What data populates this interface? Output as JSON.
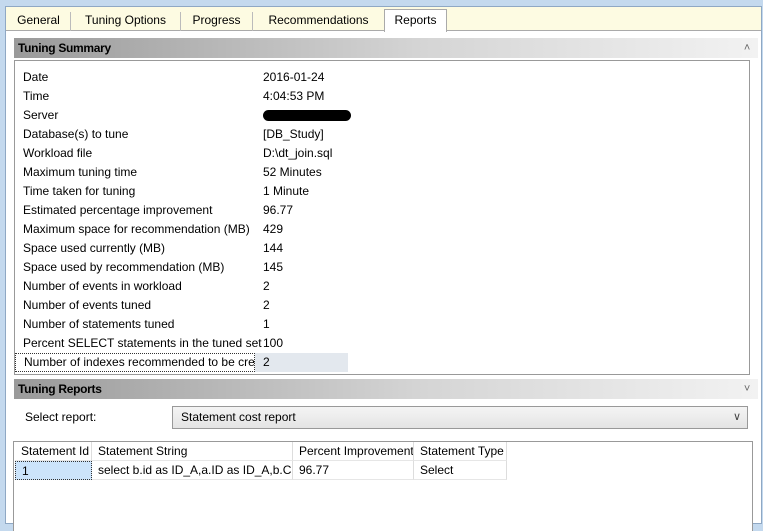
{
  "tabs": [
    {
      "label": "General"
    },
    {
      "label": "Tuning Options"
    },
    {
      "label": "Progress"
    },
    {
      "label": "Recommendations"
    },
    {
      "label": "Reports",
      "active": true
    }
  ],
  "summary": {
    "title": "Tuning Summary",
    "collapse_icon": "double-chevron-up-icon",
    "rows": [
      {
        "label": "Date",
        "value": "2016-01-24"
      },
      {
        "label": "Time",
        "value": "4:04:53 PM"
      },
      {
        "label": "Server",
        "value": ""
      },
      {
        "label": "Database(s) to tune",
        "value": "[DB_Study]"
      },
      {
        "label": "Workload file",
        "value": "D:\\dt_join.sql"
      },
      {
        "label": "Maximum tuning time",
        "value": "52 Minutes"
      },
      {
        "label": "Time taken for tuning",
        "value": "1 Minute"
      },
      {
        "label": "Estimated percentage improvement",
        "value": "96.77"
      },
      {
        "label": "Maximum space for recommendation (MB)",
        "value": "429"
      },
      {
        "label": "Space used currently (MB)",
        "value": "144"
      },
      {
        "label": "Space used by recommendation (MB)",
        "value": "145"
      },
      {
        "label": "Number of events in workload",
        "value": "2"
      },
      {
        "label": "Number of events tuned",
        "value": "2"
      },
      {
        "label": "Number of statements tuned",
        "value": "1"
      },
      {
        "label": "Percent SELECT statements in the tuned set",
        "value": "100"
      },
      {
        "label": "Number of indexes recommended to be created",
        "value": "2"
      }
    ]
  },
  "reports": {
    "title": "Tuning Reports",
    "collapse_icon": "double-chevron-down-icon",
    "select_label": "Select report:",
    "selected_report": "Statement cost report",
    "columns": [
      "Statement Id",
      "Statement String",
      "Percent Improvement",
      "Statement Type"
    ],
    "rows": [
      [
        "1",
        "select b.id as ID_A,a.ID as ID_A,b.Cr...",
        "96.77",
        "Select"
      ]
    ]
  }
}
